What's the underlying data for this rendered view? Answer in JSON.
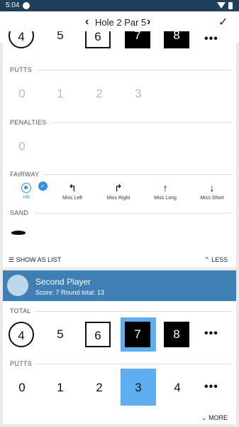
{
  "status_bar": {
    "time": "5:04"
  },
  "header": {
    "prev": "‹",
    "title": "Hole 2  Par 5",
    "next": "›",
    "confirm": "✓"
  },
  "player1": {
    "scores_row": [
      "4",
      "5",
      "6",
      "7",
      "8"
    ],
    "more": "•••",
    "putts": {
      "label": "PUTTS",
      "values": [
        "0",
        "1",
        "2",
        "3"
      ]
    },
    "penalties": {
      "label": "PENALTIES",
      "values": [
        "0"
      ]
    },
    "fairway": {
      "label": "FAIRWAY",
      "options": [
        "Hit",
        "Miss Left",
        "Miss Right",
        "Miss Long",
        "Miss Short"
      ],
      "selected": "Hit"
    },
    "sand": {
      "label": "SAND"
    },
    "show_as_list": "SHOW AS LIST",
    "less": "LESS"
  },
  "player2": {
    "name": "Second Player",
    "score_line": "Score: 7  Round total: 13",
    "total": {
      "label": "TOTAL",
      "values": [
        "4",
        "5",
        "6",
        "7",
        "8"
      ],
      "more": "•••",
      "selected": "7"
    },
    "putts": {
      "label": "PUTTS",
      "values": [
        "0",
        "1",
        "2",
        "3",
        "4"
      ],
      "more": "•••",
      "selected": "3"
    },
    "more_label": "MORE"
  },
  "colors": {
    "accent": "#3a90d8",
    "header_blue": "#3f7fb3",
    "status_bar": "#1f3e5a",
    "select_blue": "#5eaef0"
  }
}
